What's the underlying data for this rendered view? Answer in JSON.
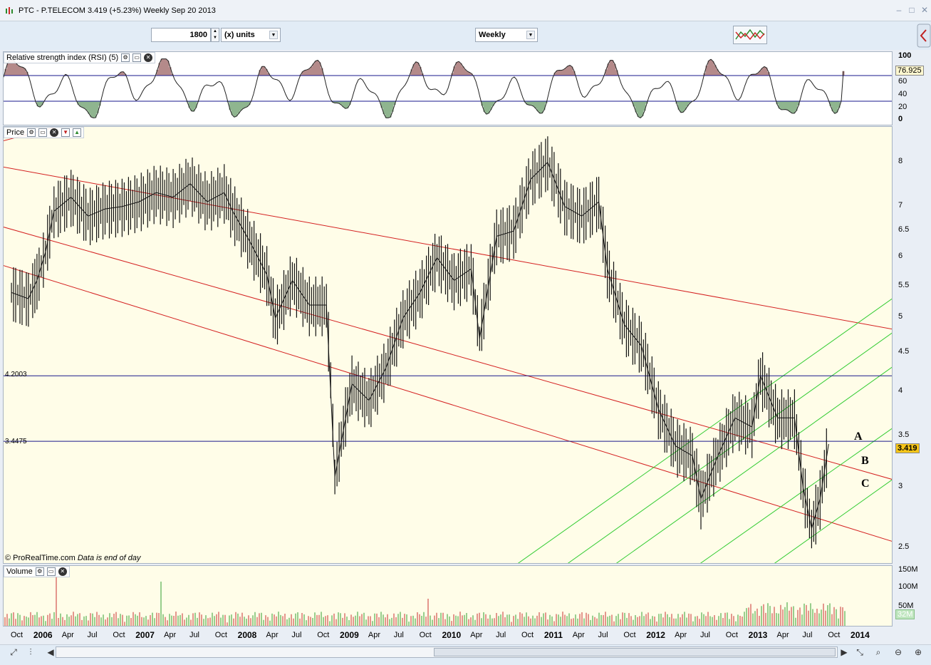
{
  "window": {
    "title": "PTC - P.TELECOM    3.419 (+5.23%)    Weekly  Sep 20 2013",
    "minimize": "–",
    "restore": "□",
    "close": "✕"
  },
  "toolbar": {
    "units_value": "1800",
    "units_select": "(x) units",
    "period_select": "Weekly",
    "chart_style_icon": "chart-style-icon"
  },
  "rsi_panel": {
    "header": "Relative strength index (RSI) (5)",
    "y_ticks": [
      "100",
      "60",
      "40",
      "20",
      "0"
    ],
    "current_value": "76.925",
    "upper_level": 70,
    "lower_level": 30
  },
  "price_panel": {
    "header": "Price",
    "y_ticks": [
      "8",
      "7",
      "6.5",
      "6",
      "5.5",
      "5",
      "4.5",
      "4",
      "3.5",
      "3",
      "2.5"
    ],
    "current_value": "3.419",
    "levels": [
      {
        "label": "4.2003",
        "value": 4.2003
      },
      {
        "label": "3.4475",
        "value": 3.4475
      }
    ],
    "annotations": [
      "A",
      "B",
      "C"
    ],
    "credit": "© ProRealTime.com",
    "credit_note": "Data is end of day"
  },
  "volume_panel": {
    "header": "Volume",
    "y_ticks": [
      "150M",
      "100M",
      "50M"
    ],
    "current_value": "32M"
  },
  "x_axis": {
    "labels": [
      {
        "text": "Oct",
        "year": false
      },
      {
        "text": "2006",
        "year": true
      },
      {
        "text": "Apr",
        "year": false
      },
      {
        "text": "Jul",
        "year": false
      },
      {
        "text": "Oct",
        "year": false
      },
      {
        "text": "2007",
        "year": true
      },
      {
        "text": "Apr",
        "year": false
      },
      {
        "text": "Jul",
        "year": false
      },
      {
        "text": "Oct",
        "year": false
      },
      {
        "text": "2008",
        "year": true
      },
      {
        "text": "Apr",
        "year": false
      },
      {
        "text": "Jul",
        "year": false
      },
      {
        "text": "Oct",
        "year": false
      },
      {
        "text": "2009",
        "year": true
      },
      {
        "text": "Apr",
        "year": false
      },
      {
        "text": "Jul",
        "year": false
      },
      {
        "text": "Oct",
        "year": false
      },
      {
        "text": "2010",
        "year": true
      },
      {
        "text": "Apr",
        "year": false
      },
      {
        "text": "Jul",
        "year": false
      },
      {
        "text": "Oct",
        "year": false
      },
      {
        "text": "2011",
        "year": true
      },
      {
        "text": "Apr",
        "year": false
      },
      {
        "text": "Jul",
        "year": false
      },
      {
        "text": "Oct",
        "year": false
      },
      {
        "text": "2012",
        "year": true
      },
      {
        "text": "Apr",
        "year": false
      },
      {
        "text": "Jul",
        "year": false
      },
      {
        "text": "Oct",
        "year": false
      },
      {
        "text": "2013",
        "year": true
      },
      {
        "text": "Apr",
        "year": false
      },
      {
        "text": "Jul",
        "year": false
      },
      {
        "text": "Oct",
        "year": false
      },
      {
        "text": "2014",
        "year": true
      }
    ]
  },
  "colors": {
    "chart_bg": "#fffde8",
    "channel_red": "#d42020",
    "fan_green": "#33cc33",
    "level_blue": "#1a1a8c",
    "volume_red": "#c83030",
    "volume_green": "#30a030",
    "rsi_overbought_fill": "#b48a8a",
    "rsi_oversold_fill": "#8fb58f"
  },
  "chart_data": {
    "type": "line",
    "title": "PTC - P.TELECOM",
    "series": [
      {
        "name": "Price",
        "points": [
          [
            "2005-09",
            5.4
          ],
          [
            "2005-11",
            5.3
          ],
          [
            "2005-12",
            5.6
          ],
          [
            "2006-01",
            6.1
          ],
          [
            "2006-02",
            6.9
          ],
          [
            "2006-04",
            7.2
          ],
          [
            "2006-06",
            6.8
          ],
          [
            "2006-08",
            6.95
          ],
          [
            "2006-10",
            7.0
          ],
          [
            "2006-12",
            7.1
          ],
          [
            "2007-02",
            7.3
          ],
          [
            "2007-04",
            7.2
          ],
          [
            "2007-06",
            7.5
          ],
          [
            "2007-08",
            7.1
          ],
          [
            "2007-10",
            7.3
          ],
          [
            "2007-11",
            6.9
          ],
          [
            "2008-01",
            6.3
          ],
          [
            "2008-03",
            5.7
          ],
          [
            "2008-04",
            5.0
          ],
          [
            "2008-06",
            5.6
          ],
          [
            "2008-08",
            5.2
          ],
          [
            "2008-10",
            5.2
          ],
          [
            "2008-11",
            3.1
          ],
          [
            "2009-01",
            4.1
          ],
          [
            "2009-03",
            3.9
          ],
          [
            "2009-05",
            4.3
          ],
          [
            "2009-07",
            5.0
          ],
          [
            "2009-09",
            5.4
          ],
          [
            "2009-11",
            6.0
          ],
          [
            "2010-01",
            5.6
          ],
          [
            "2010-03",
            5.8
          ],
          [
            "2010-04",
            4.7
          ],
          [
            "2010-06",
            6.4
          ],
          [
            "2010-08",
            6.5
          ],
          [
            "2010-10",
            7.6
          ],
          [
            "2010-12",
            8.0
          ],
          [
            "2011-02",
            7.0
          ],
          [
            "2011-04",
            6.8
          ],
          [
            "2011-06",
            7.1
          ],
          [
            "2011-07",
            5.8
          ],
          [
            "2011-09",
            4.9
          ],
          [
            "2011-11",
            4.6
          ],
          [
            "2012-01",
            3.8
          ],
          [
            "2012-03",
            3.4
          ],
          [
            "2012-05",
            3.3
          ],
          [
            "2012-06",
            2.9
          ],
          [
            "2012-08",
            3.3
          ],
          [
            "2012-10",
            3.7
          ],
          [
            "2012-12",
            3.6
          ],
          [
            "2013-01",
            4.2
          ],
          [
            "2013-03",
            3.7
          ],
          [
            "2013-05",
            3.7
          ],
          [
            "2013-06",
            3.0
          ],
          [
            "2013-07",
            2.65
          ],
          [
            "2013-08",
            2.9
          ],
          [
            "2013-09",
            3.419
          ]
        ]
      }
    ],
    "xlabel": "",
    "ylabel": "",
    "ylim": [
      2.45,
      8.6
    ],
    "y_scale": "log",
    "channel": "descending red parallel channel",
    "fan": "ascending green parallel lines",
    "horizontal_levels": [
      4.2003,
      3.4475
    ],
    "rsi": {
      "period": 5,
      "last": 76.925,
      "bands": [
        30,
        70
      ]
    },
    "volume": {
      "last": "32M",
      "max_tick": "150M"
    },
    "grid": false,
    "legend": "none"
  }
}
